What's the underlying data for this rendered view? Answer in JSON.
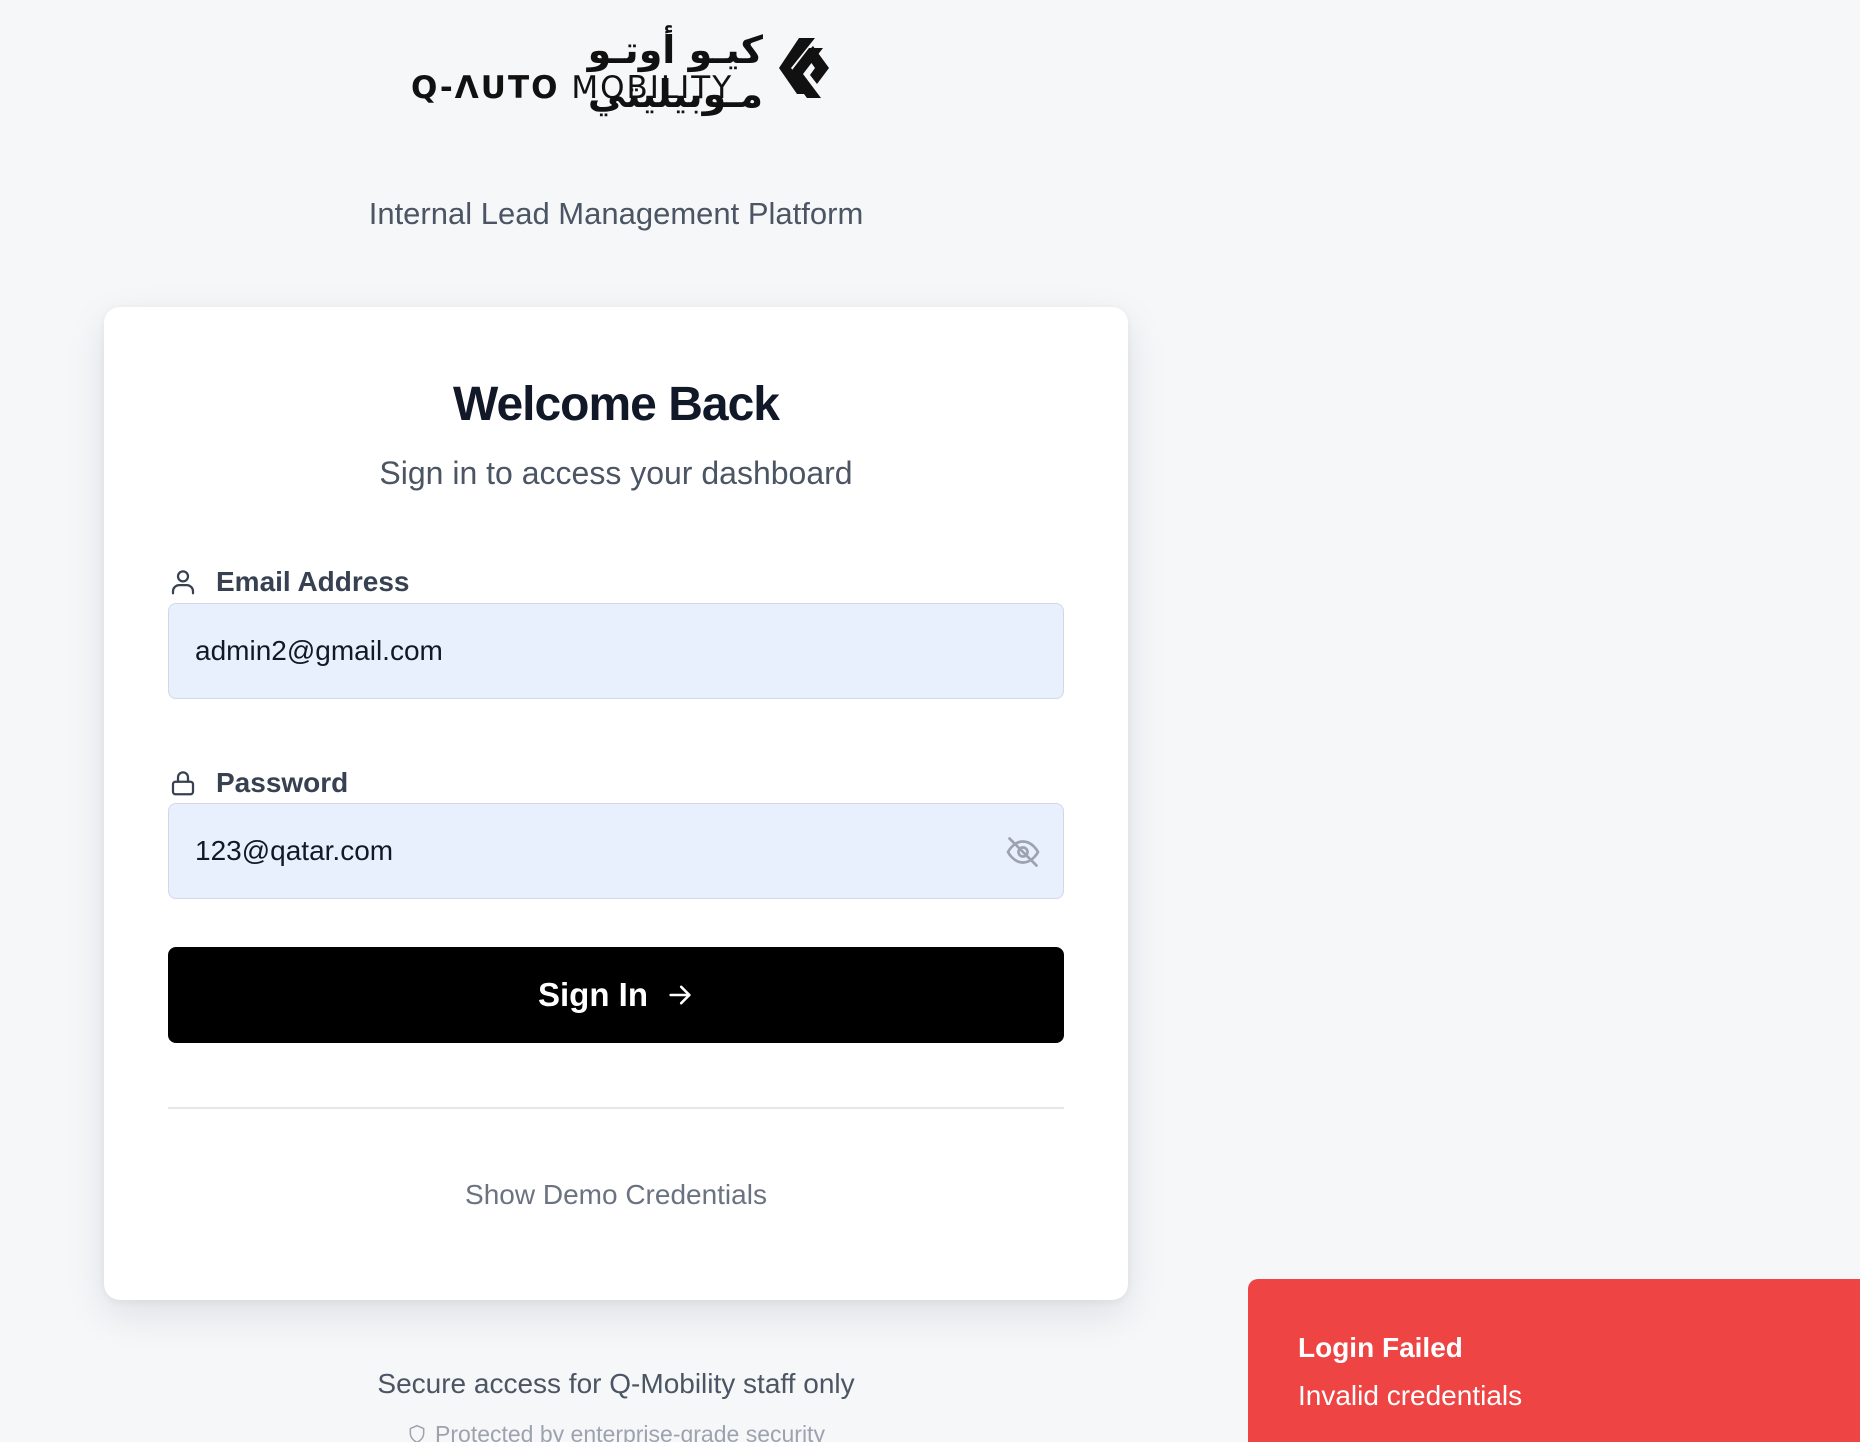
{
  "logo": {
    "arabic": "كيـو أوتـو مـوبيليتي",
    "brand": "Q-ΛUTO",
    "suffix": "MOBILITY",
    "mark_icon": "q-auto-chevron-logo-icon"
  },
  "platform_title": "Internal Lead Management Platform",
  "card": {
    "title": "Welcome Back",
    "subtitle": "Sign in to access your dashboard",
    "email": {
      "label": "Email Address",
      "icon": "user-icon",
      "value": "admin2@gmail.com"
    },
    "password": {
      "label": "Password",
      "icon": "lock-icon",
      "value": "123@qatar.com",
      "toggle_icon": "eye-off-icon"
    },
    "signin": {
      "label": "Sign In",
      "icon": "arrow-right-icon"
    },
    "demo_link": "Show Demo Credentials"
  },
  "footer": {
    "line1": "Secure access for Q-Mobility staff only",
    "line2": "Protected by enterprise-grade security",
    "line2_icon": "shield-icon"
  },
  "toast": {
    "title": "Login Failed",
    "description": "Invalid credentials",
    "color": "#ef4444"
  },
  "colors": {
    "background": "#f6f7f9",
    "input_fill": "#e8f0fe",
    "primary_button": "#000000"
  }
}
